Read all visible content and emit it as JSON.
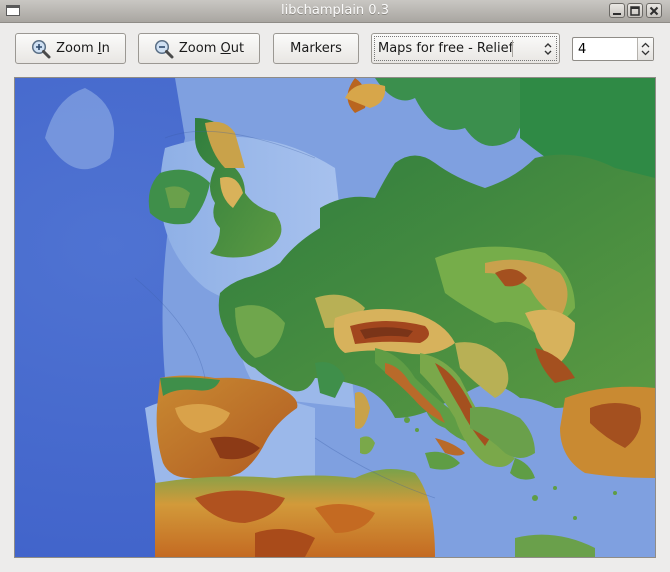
{
  "window": {
    "title": "libchamplain 0.3"
  },
  "toolbar": {
    "zoom_in_label": "Zoom In",
    "zoom_in_mnemonic": "I",
    "zoom_out_label": "Zoom Out",
    "zoom_out_mnemonic": "O",
    "markers_label": "Markers",
    "map_source": {
      "selected": "Maps for free - Relief"
    },
    "zoom_level": "4"
  },
  "icons": [
    "window-menu-icon",
    "minimize-icon",
    "maximize-icon",
    "close-icon",
    "zoom-in-icon",
    "zoom-out-icon",
    "combo-arrows-icon",
    "spin-arrows-icon"
  ],
  "colors": {
    "sea": "#6f8ed6",
    "lowland": "#3f8f4a",
    "highland": "#c8a24a",
    "mountain": "#9a4a1e",
    "desert": "#d9822b"
  }
}
